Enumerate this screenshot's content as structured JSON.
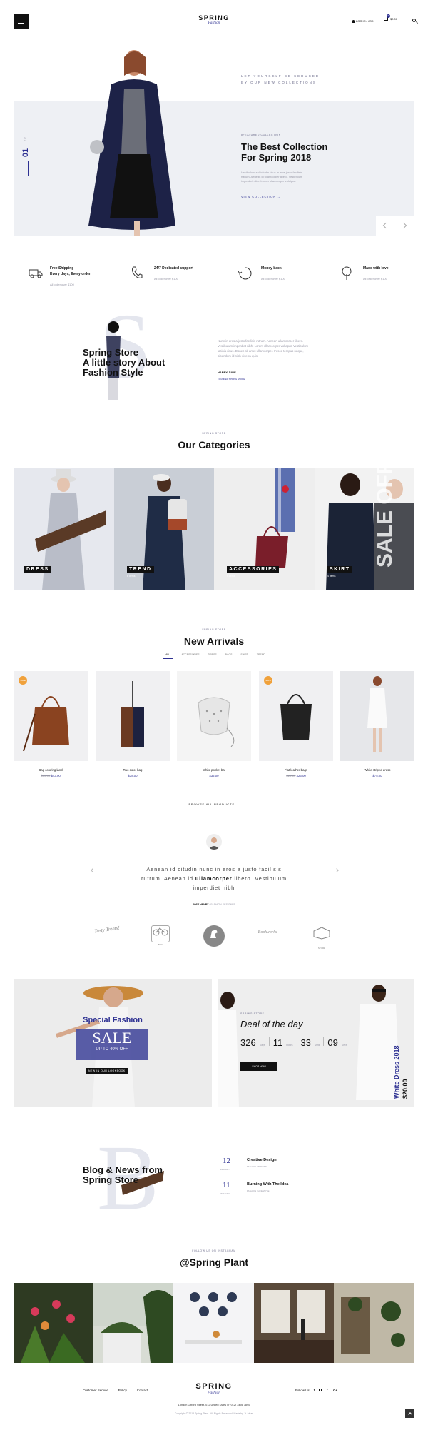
{
  "header": {
    "logo": "SPRING",
    "logo_sub": "Fashion",
    "login": "LOG IN / JOIN",
    "cart_count": "0",
    "cart_price": "$0.00"
  },
  "hero": {
    "tagline1": "LET YOURSELF BE SEDUCED",
    "tagline2": "BY OUR NEW COLLECTIONS",
    "kicker": "#FEATURED COLLECTION",
    "title1": "The Best Collection",
    "title2": "For Spring 2018",
    "desc1": "Vestibulum sollicitudin risus in eros justo facilisis",
    "desc2": "rutrum. Aenean id ullamcorper libero. Vestibulum",
    "desc3": "imperdiet nibh. Lorem ullamcorper volutpat.",
    "cta": "VIEW COLLECTION →",
    "slide_num": "01",
    "slide_total": "/ 3"
  },
  "features": [
    {
      "icon": "truck-icon",
      "title1": "Free Shipping",
      "title2": "Every days, Every order",
      "sub": "All order over $100"
    },
    {
      "icon": "phone-icon",
      "title1": "24/7 Dedicated support",
      "title2": "",
      "sub": "All order over $100"
    },
    {
      "icon": "money-icon",
      "title1": "Money back",
      "title2": "",
      "sub": "All order over $100"
    },
    {
      "icon": "tree-icon",
      "title1": "Made with love",
      "title2": "",
      "sub": "All order over $100"
    }
  ],
  "about": {
    "big_letter": "S",
    "title1": "Spring Store",
    "title2": "A little story About",
    "title3": "Fashion Style",
    "p1": "Nunc in eros a justo facilisis rutrum. Aenean ullamcorper libero.",
    "p2": "Vestibulum imperdiet nibh. Lorem ullamcorper volutpat. Vestibulum",
    "p3": "lacinia risus. Donec sit amet ullamcorper. Fusce tempus neque,",
    "p4": "bibendum id nibh viverra quis.",
    "author": "HARRY JUNE",
    "author_role": "FOUNDER SPRING STORE"
  },
  "categories": {
    "kicker": "SPRING STORE",
    "title": "Our Categories",
    "items": [
      {
        "label": "DRESS",
        "sub": ""
      },
      {
        "label": "TREND",
        "sub": "6 Items"
      },
      {
        "label": "ACCESSORIES",
        "sub": "9 Items"
      },
      {
        "label": "SKIRT",
        "sub": "4 Items"
      }
    ],
    "sale_word": "SALE OFF"
  },
  "arrivals": {
    "kicker": "SPRING STORE",
    "title": "New Arrivals",
    "tabs": [
      "ALL",
      "ACCESSORIES",
      "DRESS",
      "BAGS",
      "SHIRT",
      "TREND"
    ],
    "products": [
      {
        "name": "Bag coloring land",
        "old": "$59.00",
        "price": "$43.00",
        "badge": "SALE"
      },
      {
        "name": "Two color bag",
        "old": "",
        "price": "$38.00",
        "badge": ""
      },
      {
        "name": "White pocket bat",
        "old": "",
        "price": "$32.00",
        "badge": ""
      },
      {
        "name": "Flat leather bags",
        "old": "$29.00",
        "price": "$23.00",
        "badge": "SALE"
      },
      {
        "name": "White striped dress",
        "old": "",
        "price": "$75.00",
        "badge": ""
      }
    ],
    "browse": "BROWSE ALL PRODUCTS →"
  },
  "testimonial": {
    "line1": "Aenean id citudin nunc in eros a justo facilisis",
    "line2a": "rutrum. Aenean id ",
    "line2b": "ullamcorper",
    "line2c": " libero. Vestibulum",
    "line3": "imperdiet nibh",
    "name": "JOSE HENRY",
    "role": "/ FASHION DESIGNER"
  },
  "brands": [
    "Tasty Treats!",
    "BIKE",
    "HORSE",
    "Bookworks",
    "STORE"
  ],
  "promo": {
    "special": "Special Fashion",
    "sale": "SALE",
    "upto": "UP TO 40% OFF",
    "lookbook": "NEW IN OUR LOOKBOOK",
    "deal_kicker": "SPRING STORE",
    "deal_title": "Deal of the day",
    "countdown": [
      {
        "num": "326",
        "unit": "Days"
      },
      {
        "num": "11",
        "unit": "Hours"
      },
      {
        "num": "33",
        "unit": "Mins"
      },
      {
        "num": "09",
        "unit": "Secs"
      }
    ],
    "shop": "SHOP NOW",
    "vertical_title": "White Dress 2018",
    "vertical_price": "$20.00"
  },
  "blog": {
    "big_letter": "B",
    "title1": "Blog & News from",
    "title2": "Spring Store",
    "posts": [
      {
        "day": "12",
        "month": "JANUARY",
        "title": "Creative Design",
        "meta": "FASHION / TRENDS"
      },
      {
        "day": "11",
        "month": "JANUARY",
        "title": "Burning With The Idea",
        "meta": "FASHION / LIFESTYLE"
      }
    ]
  },
  "instagram": {
    "kicker": "FOLLOW US ON INSTAGRAM",
    "title": "@Spring Plant"
  },
  "footer": {
    "links": [
      "Customer Service",
      "Policy",
      "Contact"
    ],
    "logo": "SPRING",
    "logo_sub": "Fashion",
    "follow": "Follow Us",
    "address": "London Oxford Street, 012 United Kstes  |  (+012) 3456 7890",
    "copyright": "Copyright © 2018 Spring Plant . All Rights Reserved. Made by Jt. Ideas"
  },
  "colors": {
    "accent": "#2e3192",
    "sale_badge": "#f0a13b",
    "dark": "#111111"
  }
}
